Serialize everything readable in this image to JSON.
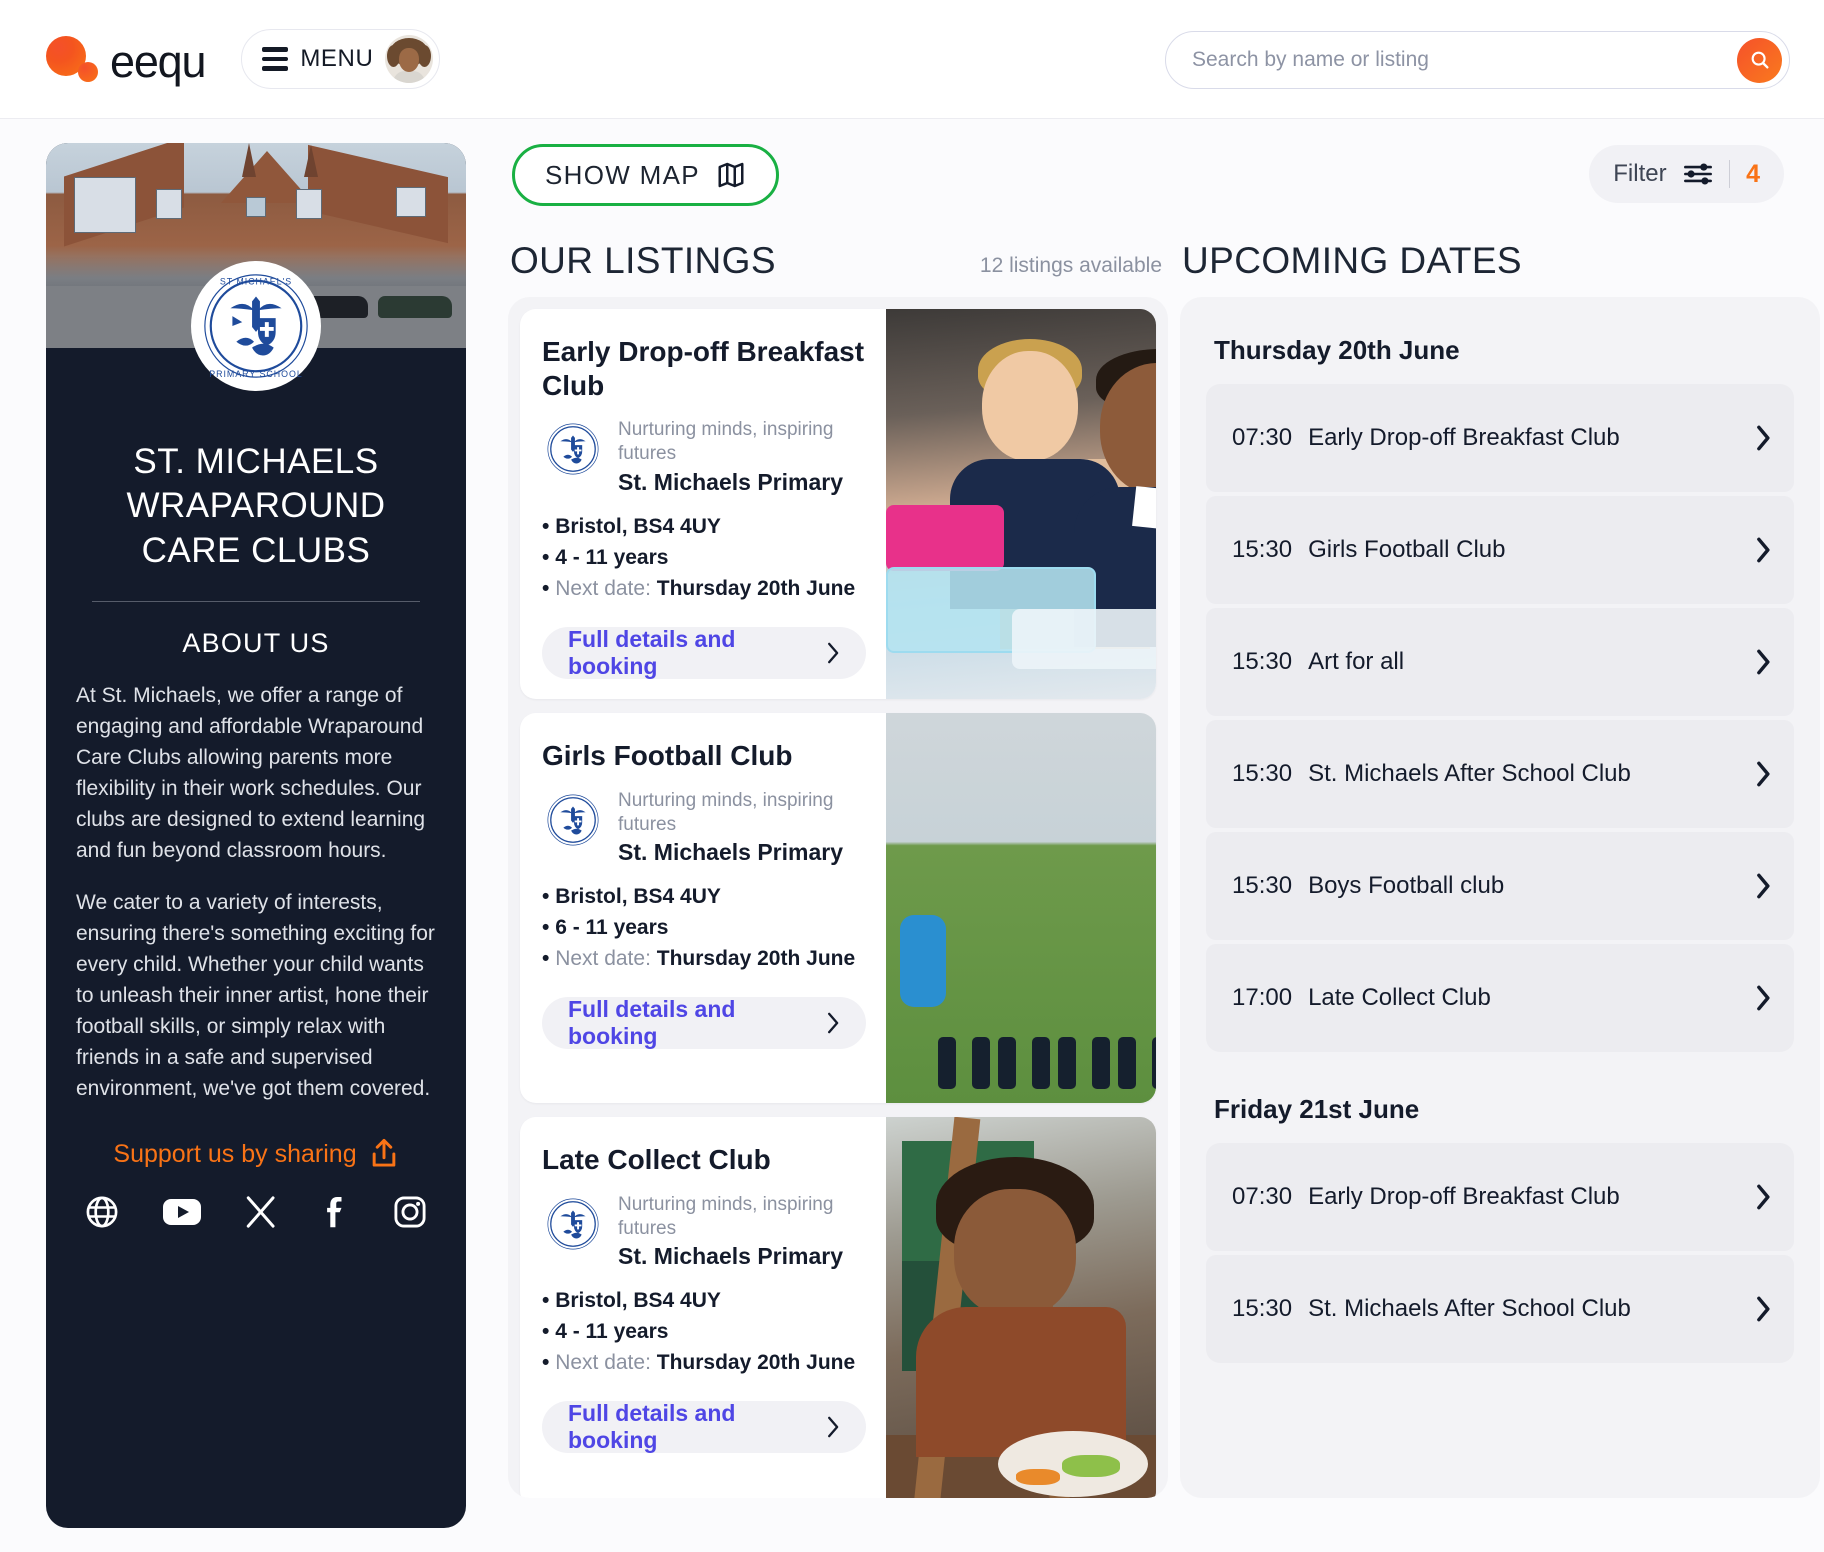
{
  "brand": {
    "name": "eequ"
  },
  "header": {
    "menu_label": "MENU",
    "avatar_name": "user-avatar",
    "search": {
      "placeholder": "Search by name or listing",
      "value": "",
      "button_icon": "search-icon"
    }
  },
  "toolbar": {
    "show_map_label": "SHOW MAP",
    "show_map_icon": "map-icon",
    "show_map_border_color": "#19b043",
    "filter_label": "Filter",
    "filter_icon": "sliders-icon",
    "filter_count": "4",
    "filter_count_color": "#f97316"
  },
  "sidebar": {
    "photo_alt": "school-building-photo",
    "crest_alt": "st-michaels-crest",
    "title": "ST. MICHAELS WRAPAROUND CARE CLUBS",
    "about_heading": "ABOUT US",
    "about_paragraphs": [
      "At St. Michaels, we offer a range of engaging and affordable Wraparound Care Clubs allowing parents more flexibility in their work schedules. Our clubs are designed to extend learning and fun beyond classroom hours.",
      "We cater to a variety of interests, ensuring there's something exciting for every child. Whether your child wants to unleash their inner artist, hone their football skills, or simply relax with friends in a safe and supervised environment, we've got them covered."
    ],
    "share_label": "Support us by sharing",
    "share_icon": "share-upload-icon",
    "share_color": "#f97316",
    "social": [
      {
        "name": "website-icon",
        "label": "Website"
      },
      {
        "name": "youtube-icon",
        "label": "YouTube"
      },
      {
        "name": "x-twitter-icon",
        "label": "X"
      },
      {
        "name": "facebook-icon",
        "label": "Facebook"
      },
      {
        "name": "instagram-icon",
        "label": "Instagram"
      }
    ]
  },
  "listings": {
    "section_title": "OUR LISTINGS",
    "count_label": "12 listings available",
    "cta_label": "Full details and booking",
    "cta_icon": "chevron-right-icon",
    "org_tagline": "Nurturing minds, inspiring futures",
    "org_name": "St. Michaels Primary",
    "next_date_label": "Next date:",
    "items": [
      {
        "title": "Early Drop-off Breakfast Club",
        "tagline": "Nurturing minds, inspiring futures",
        "org": "St. Michaels Primary",
        "location": "Bristol, BS4 4UY",
        "ages": "4 - 11 years",
        "next_date": "Thursday 20th June",
        "photo_alt": "children-eating-breakfast-photo"
      },
      {
        "title": "Girls Football Club",
        "tagline": "Nurturing minds, inspiring futures",
        "org": "St. Michaels Primary",
        "location": "Bristol, BS4 4UY",
        "ages": "6 - 11 years",
        "next_date": "Thursday 20th June",
        "photo_alt": "girls-football-team-photo"
      },
      {
        "title": "Late Collect Club",
        "tagline": "Nurturing minds, inspiring futures",
        "org": "St. Michaels Primary",
        "location": "Bristol, BS4 4UY",
        "ages": "4 - 11 years",
        "next_date": "Thursday 20th June",
        "photo_alt": "child-painting-at-easel-photo"
      }
    ]
  },
  "upcoming": {
    "section_title": "UPCOMING DATES",
    "days": [
      {
        "date": "Thursday 20th June",
        "events": [
          {
            "time": "07:30",
            "name": "Early Drop-off Breakfast Club"
          },
          {
            "time": "15:30",
            "name": "Girls Football Club"
          },
          {
            "time": "15:30",
            "name": "Art for all"
          },
          {
            "time": "15:30",
            "name": "St. Michaels After School Club"
          },
          {
            "time": "15:30",
            "name": "Boys Football club"
          },
          {
            "time": "17:00",
            "name": "Late Collect Club"
          }
        ]
      },
      {
        "date": "Friday 21st June",
        "events": [
          {
            "time": "07:30",
            "name": "Early Drop-off Breakfast Club"
          },
          {
            "time": "15:30",
            "name": "St. Michaels After School Club"
          }
        ]
      }
    ]
  }
}
